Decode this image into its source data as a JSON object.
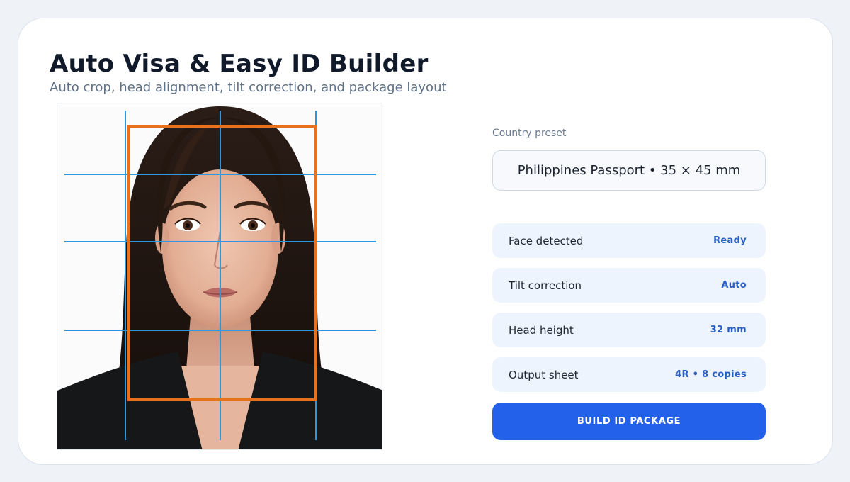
{
  "header": {
    "title": "Auto Visa & Easy ID Builder",
    "subtitle": "Auto crop, head alignment, tilt correction, and package layout"
  },
  "preview": {
    "image_alt": "Portrait photo of a woman with long dark hair in a black blazer",
    "crop_box_color": "#e8711d",
    "guide_line_color": "#2b97e0"
  },
  "preset": {
    "label": "Country preset",
    "value": "Philippines Passport • 35 × 45 mm"
  },
  "status_rows": [
    {
      "label": "Face detected",
      "value": "Ready"
    },
    {
      "label": "Tilt correction",
      "value": "Auto"
    },
    {
      "label": "Head height",
      "value": "32 mm"
    },
    {
      "label": "Output sheet",
      "value": "4R • 8 copies"
    }
  ],
  "actions": {
    "build_label": "BUILD ID PACKAGE"
  },
  "colors": {
    "accent": "#2461ea",
    "status_value": "#2a5fc4",
    "row_background": "#edf4fd"
  }
}
